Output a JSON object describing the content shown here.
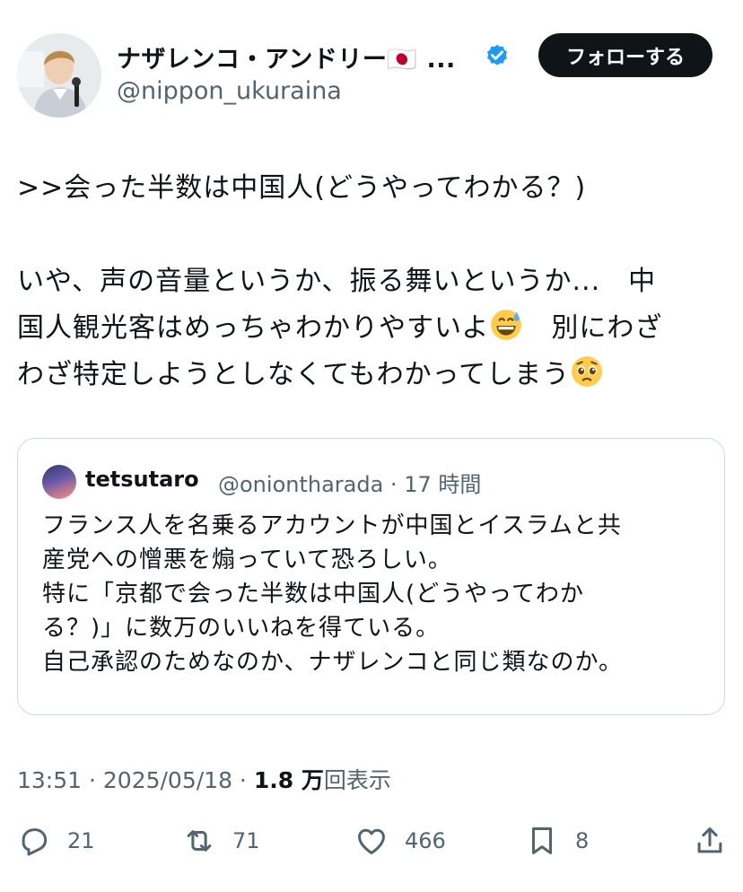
{
  "author": {
    "name": "ナザレンコ・アンドリー🇯🇵 ...",
    "handle": "@nippon_ukuraina",
    "follow_label": "フォローする"
  },
  "tweet": {
    "text_line1": ">>会った半数は中国人(どうやってわかる？)",
    "text_line2": "いや、声の音量というか、振る舞いというか...　中",
    "text_line3a": "国人観光客はめっちゃわかりやすいよ",
    "text_line3b": "　別にわざ",
    "text_line4": "わざ特定しようとしなくてもわかってしまう",
    "emoji1": "grinning-sweat-emoji",
    "emoji2": "pleading-face-emoji"
  },
  "quote": {
    "name": "tetsutaro",
    "handle": "@oniontharada · 17 時間",
    "text": "フランス人を名乗るアカウントが中国とイスラムと共\n産党への憎悪を煽っていて恐ろしい。\n特に「京都で会った半数は中国人(どうやってわか\nる？)」に数万のいいねを得ている。\n自己承認のためなのか、ナザレンコと同じ類なのか。"
  },
  "meta": {
    "time": "13:51 · 2025/05/18 · ",
    "views_count": "1.8 万",
    "views_label": "回表示"
  },
  "actions": {
    "replies": "21",
    "reposts": "71",
    "likes": "466",
    "bookmarks": "8"
  },
  "colors": {
    "text": "#0f1419",
    "secondary": "#536471",
    "verified": "#1d9bf0",
    "border": "#cfd9de"
  }
}
